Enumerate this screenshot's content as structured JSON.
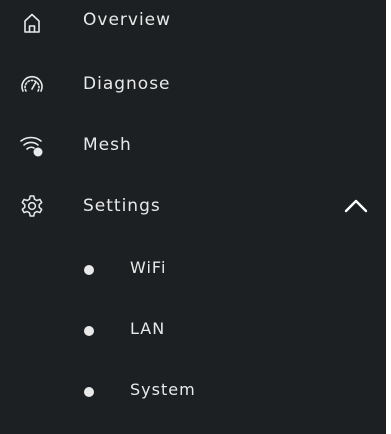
{
  "sidebar": {
    "items": [
      {
        "label": "Overview",
        "icon": "home-icon"
      },
      {
        "label": "Diagnose",
        "icon": "gauge-icon"
      },
      {
        "label": "Mesh",
        "icon": "wifi-mesh-icon"
      },
      {
        "label": "Settings",
        "icon": "gear-icon",
        "expanded": true,
        "chevron": "chevron-up-icon"
      }
    ],
    "subitems": [
      {
        "label": "WiFi"
      },
      {
        "label": "LAN"
      },
      {
        "label": "System"
      }
    ]
  },
  "colors": {
    "background": "#1d2022",
    "text": "#e9e9e9"
  }
}
